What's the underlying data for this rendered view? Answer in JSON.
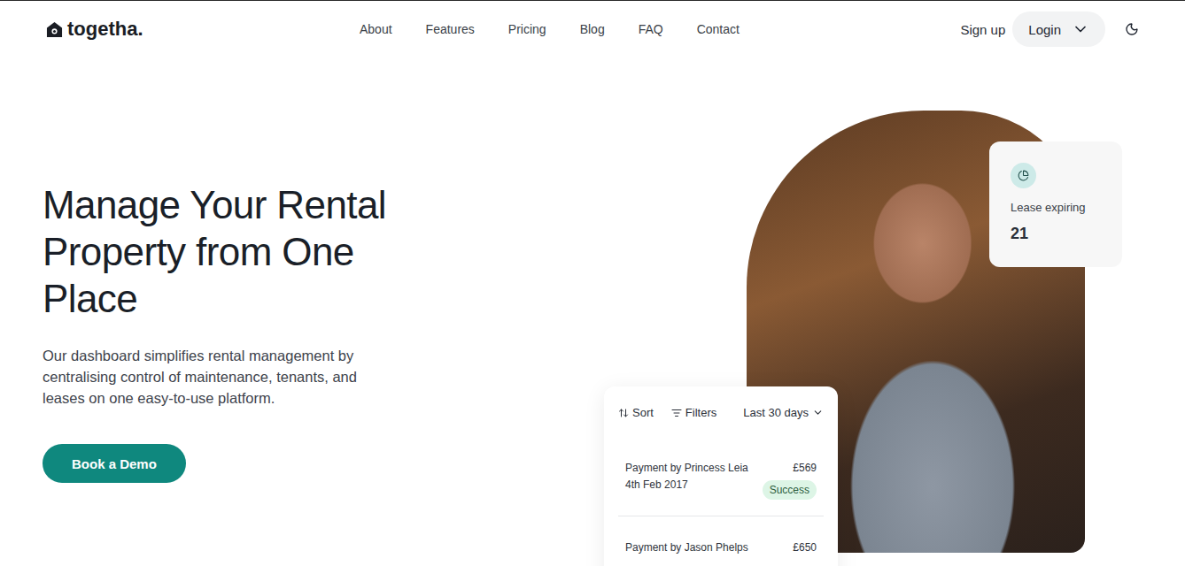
{
  "header": {
    "logo": "togetha.",
    "nav": [
      "About",
      "Features",
      "Pricing",
      "Blog",
      "FAQ",
      "Contact"
    ],
    "signup": "Sign up",
    "login": "Login"
  },
  "hero": {
    "title": "Manage Your Rental Property from One Place",
    "description": "Our dashboard simplifies rental management by centralising control of maintenance, tenants, and leases on one easy-to-use platform.",
    "cta": "Book a Demo"
  },
  "lease_card": {
    "label": "Lease expiring",
    "value": "21"
  },
  "payments_card": {
    "toolbar": {
      "sort": "Sort",
      "filters": "Filters",
      "range": "Last 30 days"
    },
    "rows": [
      {
        "name": "Payment by Princess Leia",
        "date": "4th Feb 2017",
        "amount": "£569",
        "status": "Success"
      },
      {
        "name": "Payment by Jason Phelps",
        "amount": "£650"
      }
    ]
  }
}
